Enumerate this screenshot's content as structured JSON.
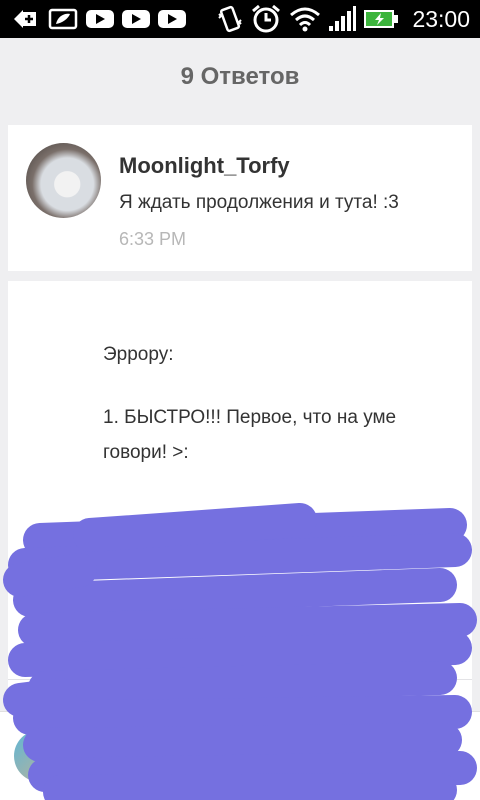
{
  "status_bar": {
    "time": "23:00",
    "icons": [
      "add-icon",
      "leaf-card-icon",
      "youtube-icon",
      "youtube-icon",
      "youtube-icon",
      "vibrate-icon",
      "alarm-icon",
      "wifi-icon",
      "signal-icon",
      "battery-charging-icon"
    ]
  },
  "header": {
    "title": "9 Ответов"
  },
  "comment": {
    "user": "Moonlight_Torfy",
    "text": "Я ждать продолжения и тута! :3",
    "time": "6:33 PM"
  },
  "message": {
    "lines": [
      "Эррору:",
      "1. БЫСТРО!!! Первое, что на уме",
      "говори! >:"
    ]
  },
  "colors": {
    "scribble": "#7570e0",
    "background": "#efeff1",
    "card": "#ffffff",
    "time_text": "#b7b7b7"
  }
}
